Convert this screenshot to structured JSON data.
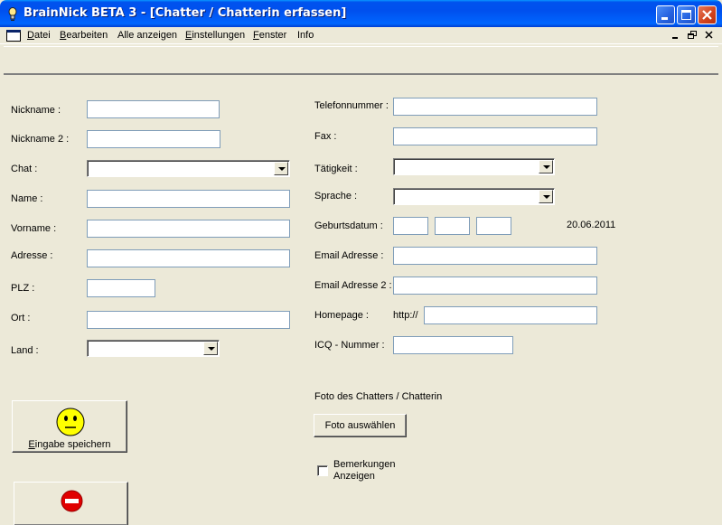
{
  "window": {
    "title": "BrainNick BETA 3 - [Chatter / Chatterin erfassen]"
  },
  "menu": [
    {
      "first": "D",
      "rest": "atei"
    },
    {
      "first": "B",
      "rest": "earbeiten"
    },
    {
      "first": "",
      "rest": "Alle anzeigen"
    },
    {
      "first": "E",
      "rest": "instellungen"
    },
    {
      "first": "F",
      "rest": "enster"
    },
    {
      "first": "",
      "rest": "Info"
    }
  ],
  "form": {
    "nickname": {
      "label": "Nickname :",
      "value": ""
    },
    "nickname2": {
      "label": "Nickname 2 :",
      "value": ""
    },
    "chat": {
      "label": "Chat :",
      "value": ""
    },
    "name": {
      "label": "Name :",
      "value": ""
    },
    "vorname": {
      "label": "Vorname :",
      "value": ""
    },
    "adresse": {
      "label": "Adresse :",
      "value": ""
    },
    "plz": {
      "label": "PLZ :",
      "value": ""
    },
    "ort": {
      "label": "Ort :",
      "value": ""
    },
    "land": {
      "label": "Land :",
      "value": ""
    },
    "telefon": {
      "label": "Telefonnummer :",
      "value": ""
    },
    "fax": {
      "label": "Fax :",
      "value": ""
    },
    "taetigkeit": {
      "label": "Tätigkeit :",
      "value": ""
    },
    "sprache": {
      "label": "Sprache :",
      "value": ""
    },
    "geburtsdatum": {
      "label": "Geburtsdatum :",
      "day": "",
      "month": "",
      "year": "",
      "today": "20.06.2011"
    },
    "email": {
      "label": "Email Adresse :",
      "value": ""
    },
    "email2": {
      "label": "Email Adresse 2 :",
      "value": ""
    },
    "homepage": {
      "label": "Homepage :",
      "prefix": "http://",
      "value": ""
    },
    "icq": {
      "label": "ICQ - Nummer :",
      "value": ""
    },
    "foto": {
      "label": "Foto des Chatters / Chatterin",
      "button": "Foto auswählen"
    },
    "bemerkungen": {
      "line1": "Bemerkungen",
      "line2": "Anzeigen",
      "checked": false
    }
  },
  "buttons": {
    "save_first": "E",
    "save_rest": "ingabe speichern"
  },
  "icons": {
    "save": "neutral-face-icon",
    "cancel": "stop-icon"
  }
}
